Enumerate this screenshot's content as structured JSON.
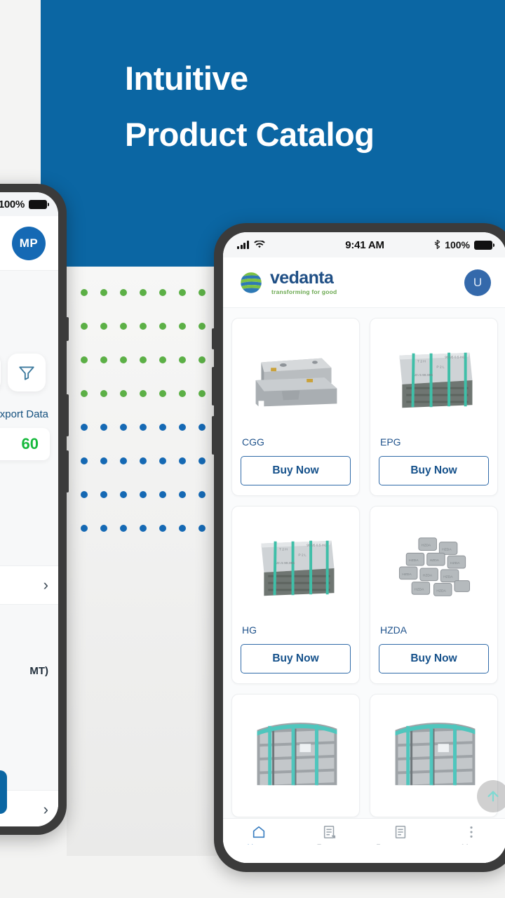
{
  "banner": {
    "line1": "Intuitive",
    "line2": "Product Catalog",
    "bg_color": "#0b66a3",
    "text_color": "#ffffff"
  },
  "decor": {
    "dot_green": "#5cb046",
    "dot_blue": "#1569b4",
    "rows": 8,
    "cols": 7,
    "green_rows": 4
  },
  "left_phone": {
    "status_bar": {
      "battery_percent": "100%",
      "bluetooth_icon": "bluetooth-icon"
    },
    "header": {
      "avatar_initials": "MP",
      "avatar_color": "#1569b4"
    },
    "filter_icon": "filter-funnel-icon",
    "export_label": "xport Data",
    "count_value": "60",
    "count_color": "#16b93c",
    "unit_label": "MT)",
    "chevron_icon": "chevron-right-icon"
  },
  "right_phone": {
    "status_bar": {
      "signal_icon": "cellular-signal-icon",
      "wifi_icon": "wifi-icon",
      "time": "9:41 AM",
      "bluetooth_icon": "bluetooth-icon",
      "battery_percent": "100%"
    },
    "header": {
      "logo_icon": "vedanta-globe-icon",
      "logo_name": "vedanta",
      "logo_tagline": "transforming for good",
      "avatar_initial": "U",
      "avatar_color": "#3469ab"
    },
    "catalog": {
      "buy_label": "Buy Now",
      "products": [
        {
          "code": "CGG",
          "image": "aluminium-sow-ingot-photo"
        },
        {
          "code": "EPG",
          "image": "zinc-ingot-bundle-photo"
        },
        {
          "code": "HG",
          "image": "zinc-ingot-stack-photo"
        },
        {
          "code": "HZDA",
          "image": "hzda-die-cast-alloy-photo"
        },
        {
          "code": "",
          "image": "aluminium-ingot-stack-photo"
        },
        {
          "code": "",
          "image": "aluminium-ingot-stack-photo-2"
        }
      ]
    },
    "fab": {
      "icon": "scroll-to-top-arrow-icon"
    },
    "tabbar": {
      "active_color": "#3a7ec0",
      "inactive_color": "#9aa3ab",
      "items": [
        {
          "label": "Home",
          "icon": "home-icon",
          "active": true
        },
        {
          "label": "Report",
          "icon": "report-doc-icon",
          "active": false
        },
        {
          "label": "Procurement",
          "icon": "procurement-doc-icon",
          "active": false
        },
        {
          "label": "More",
          "icon": "more-kebab-icon",
          "active": false
        }
      ]
    }
  }
}
